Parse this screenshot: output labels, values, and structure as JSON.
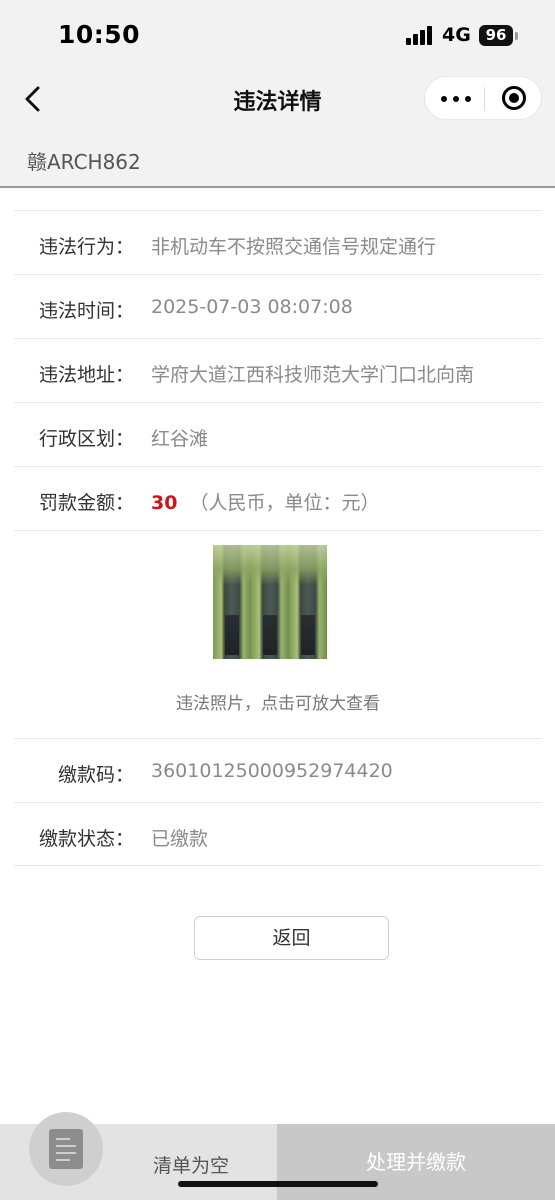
{
  "status_bar": {
    "time": "10:50",
    "network": "4G",
    "battery": "96"
  },
  "nav": {
    "title": "违法详情"
  },
  "plate": "赣ARCH862",
  "details": {
    "behavior": {
      "label": "违法行为：",
      "value": "非机动车不按照交通信号规定通行"
    },
    "time": {
      "label": "违法时间：",
      "value": "2025-07-03 08:07:08"
    },
    "address": {
      "label": "违法地址：",
      "value": "学府大道江西科技师范大学门口北向南"
    },
    "district": {
      "label": "行政区划：",
      "value": "红谷滩"
    },
    "fine": {
      "label": "罚款金额：",
      "amount": "30",
      "unit": "（人民币，单位：元）"
    },
    "photo_caption": "违法照片，点击可放大查看",
    "payment_code": {
      "label": "缴款码：",
      "value": "36010125000952974420"
    },
    "payment_status": {
      "label": "缴款状态：",
      "value": "已缴款"
    }
  },
  "actions": {
    "back": "返回"
  },
  "bottom_bar": {
    "empty_label": "清单为空",
    "pay_label": "处理并缴款"
  },
  "colors": {
    "fine_amount": "#d0121b",
    "pay_button_bg": "#c8c8c8"
  }
}
